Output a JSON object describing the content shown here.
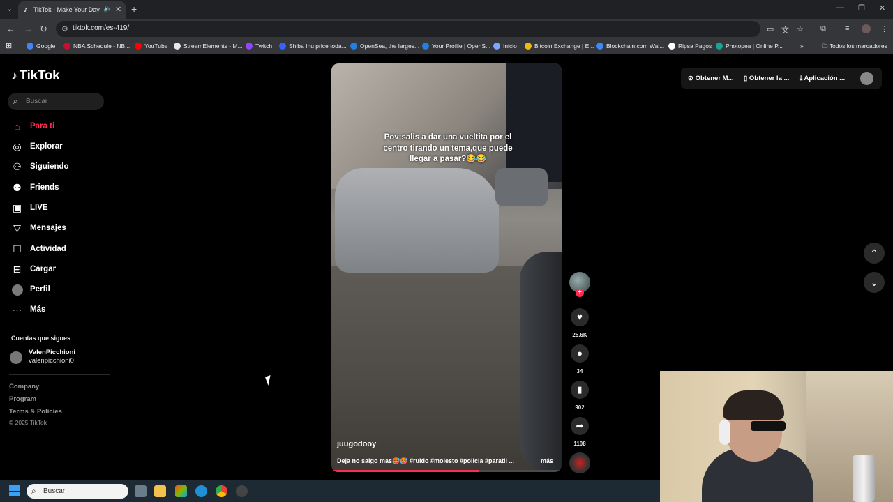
{
  "browser": {
    "tab_title": "TikTok - Make Your Day",
    "url": "tiktok.com/es-419/",
    "bookmarks": [
      {
        "label": "Google",
        "color": "#4285f4"
      },
      {
        "label": "NBA Schedule - NB...",
        "color": "#c8102e"
      },
      {
        "label": "YouTube",
        "color": "#ff0000"
      },
      {
        "label": "StreamElements - M...",
        "color": "#e8e8e8"
      },
      {
        "label": "Twitch",
        "color": "#9146ff"
      },
      {
        "label": "Shiba Inu price toda...",
        "color": "#3861fb"
      },
      {
        "label": "OpenSea, the larges...",
        "color": "#2081e2"
      },
      {
        "label": "Your Profile | OpenS...",
        "color": "#2081e2"
      },
      {
        "label": "Inicio",
        "color": "#7aa7ff"
      },
      {
        "label": "Bitcoin Exchange | E...",
        "color": "#f0b90b"
      },
      {
        "label": "Blockchain.com Wal...",
        "color": "#3d89f5"
      },
      {
        "label": "Ripsa Pagos",
        "color": "#ffffff"
      },
      {
        "label": "Photopea | Online P...",
        "color": "#18a497"
      }
    ],
    "all_bookmarks": "Todos los marcadores"
  },
  "tiktok": {
    "logo": "TikTok",
    "search_placeholder": "Buscar",
    "nav": [
      {
        "label": "Para ti",
        "icon": "home-icon"
      },
      {
        "label": "Explorar",
        "icon": "compass-icon"
      },
      {
        "label": "Siguiendo",
        "icon": "following-icon"
      },
      {
        "label": "Friends",
        "icon": "friends-icon"
      },
      {
        "label": "LIVE",
        "icon": "live-icon"
      },
      {
        "label": "Mensajes",
        "icon": "messages-icon"
      },
      {
        "label": "Actividad",
        "icon": "activity-icon"
      },
      {
        "label": "Cargar",
        "icon": "upload-icon"
      },
      {
        "label": "Perfil",
        "icon": "profile-icon"
      },
      {
        "label": "Más",
        "icon": "more-icon"
      }
    ],
    "following_header": "Cuentas que sigues",
    "followed_account": {
      "name": "ValenPicchioni",
      "handle": "valenpicchioni0"
    },
    "footer": [
      "Company",
      "Program",
      "Terms & Policies"
    ],
    "copyright": "© 2025 TikTok",
    "top_buttons": [
      "Obtener M...",
      "Obtener la ...",
      "Aplicación ..."
    ]
  },
  "video": {
    "caption": "Pov:salis a dar una vueltita por el centro tirando un tema,que puede llegar a pasar?😂😂",
    "username": "juugodooy",
    "description": "Deja no salgo mas🥵🥵 #ruido #molesto #policia  #paratii ...",
    "more": "más",
    "progress": 0.64,
    "likes": "25.6K",
    "comments": "34",
    "saves": "902",
    "shares": "1108"
  },
  "taskbar": {
    "search_placeholder": "Buscar"
  }
}
